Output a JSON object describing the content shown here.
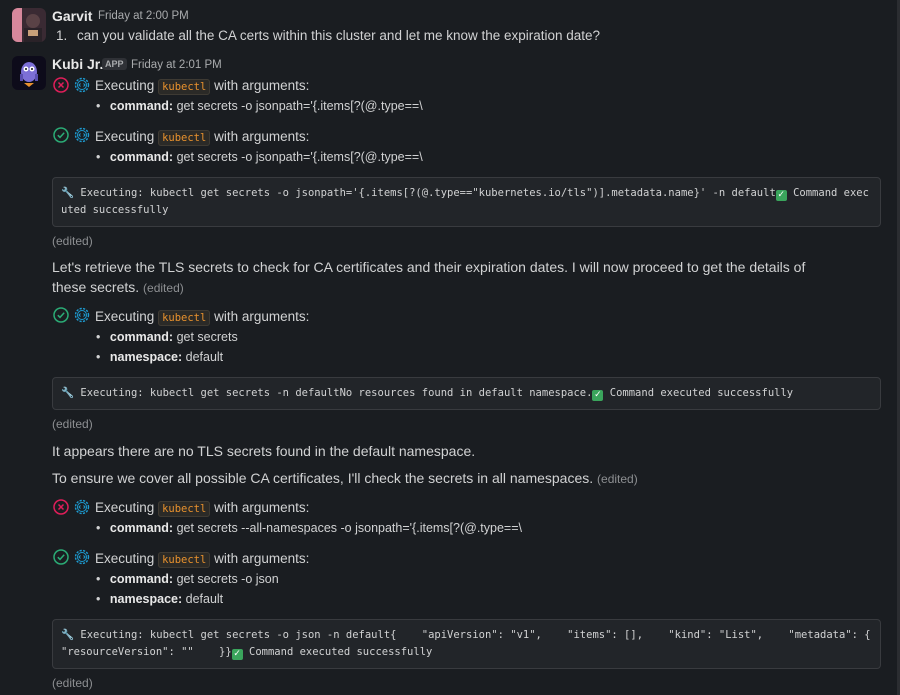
{
  "msg1": {
    "author": "Garvit",
    "time": "Friday at 2:00 PM",
    "list_number": "1.",
    "text": "can you validate all the CA certs within this cluster and let me know the expiration date?"
  },
  "msg2": {
    "author": "Kubi Jr.",
    "badge": "APP",
    "time": "Friday at 2:01 PM",
    "exec_prefix": "Executing",
    "exec_tool": "kubectl",
    "exec_suffix": "with arguments:",
    "label_command": "command:",
    "label_namespace": "namespace:",
    "blocks": [
      {
        "status": "error",
        "command": "get secrets -o jsonpath='{.items[?(@.type==\\"
      },
      {
        "status": "success",
        "command": "get secrets -o jsonpath='{.items[?(@.type==\\"
      }
    ],
    "code1_a": "🔧 Executing: kubectl get secrets -o jsonpath='{.items[?(@.type==\"kubernetes.io/tls\")].metadata.name}' -n default",
    "code1_b": " Command executed successfully",
    "edited": "(edited)",
    "para1": "Let's retrieve the TLS secrets to check for CA certificates and their expiration dates. I will now proceed to get the details of these secrets.",
    "block3": {
      "status": "success",
      "command": "get secrets",
      "namespace": "default"
    },
    "code2_a": "🔧 Executing: kubectl get secrets -n defaultNo resources found in default namespace.",
    "code2_b": " Command executed successfully",
    "para2": "It appears there are no TLS secrets found in the default namespace.",
    "para3": "To ensure we cover all possible CA certificates, I'll check the secrets in all namespaces.",
    "block4": {
      "status": "error",
      "command": "get secrets --all-namespaces -o jsonpath='{.items[?(@.type==\\"
    },
    "block5": {
      "status": "success",
      "command": "get secrets -o json",
      "namespace": "default"
    },
    "code3_a": "🔧 Executing: kubectl get secrets -o json -n default{    \"apiVersion\": \"v1\",    \"items\": [],    \"kind\": \"List\",    \"metadata\": {        \"resourceVersion\": \"\"    }}",
    "code3_b": " Command executed successfully"
  },
  "colors": {
    "background": "#1a1d21",
    "error": "#e01e5a",
    "success": "#2bac76",
    "gear": "#1d9bd1",
    "code_accent": "#e8912d",
    "check": "#3aa55c"
  }
}
